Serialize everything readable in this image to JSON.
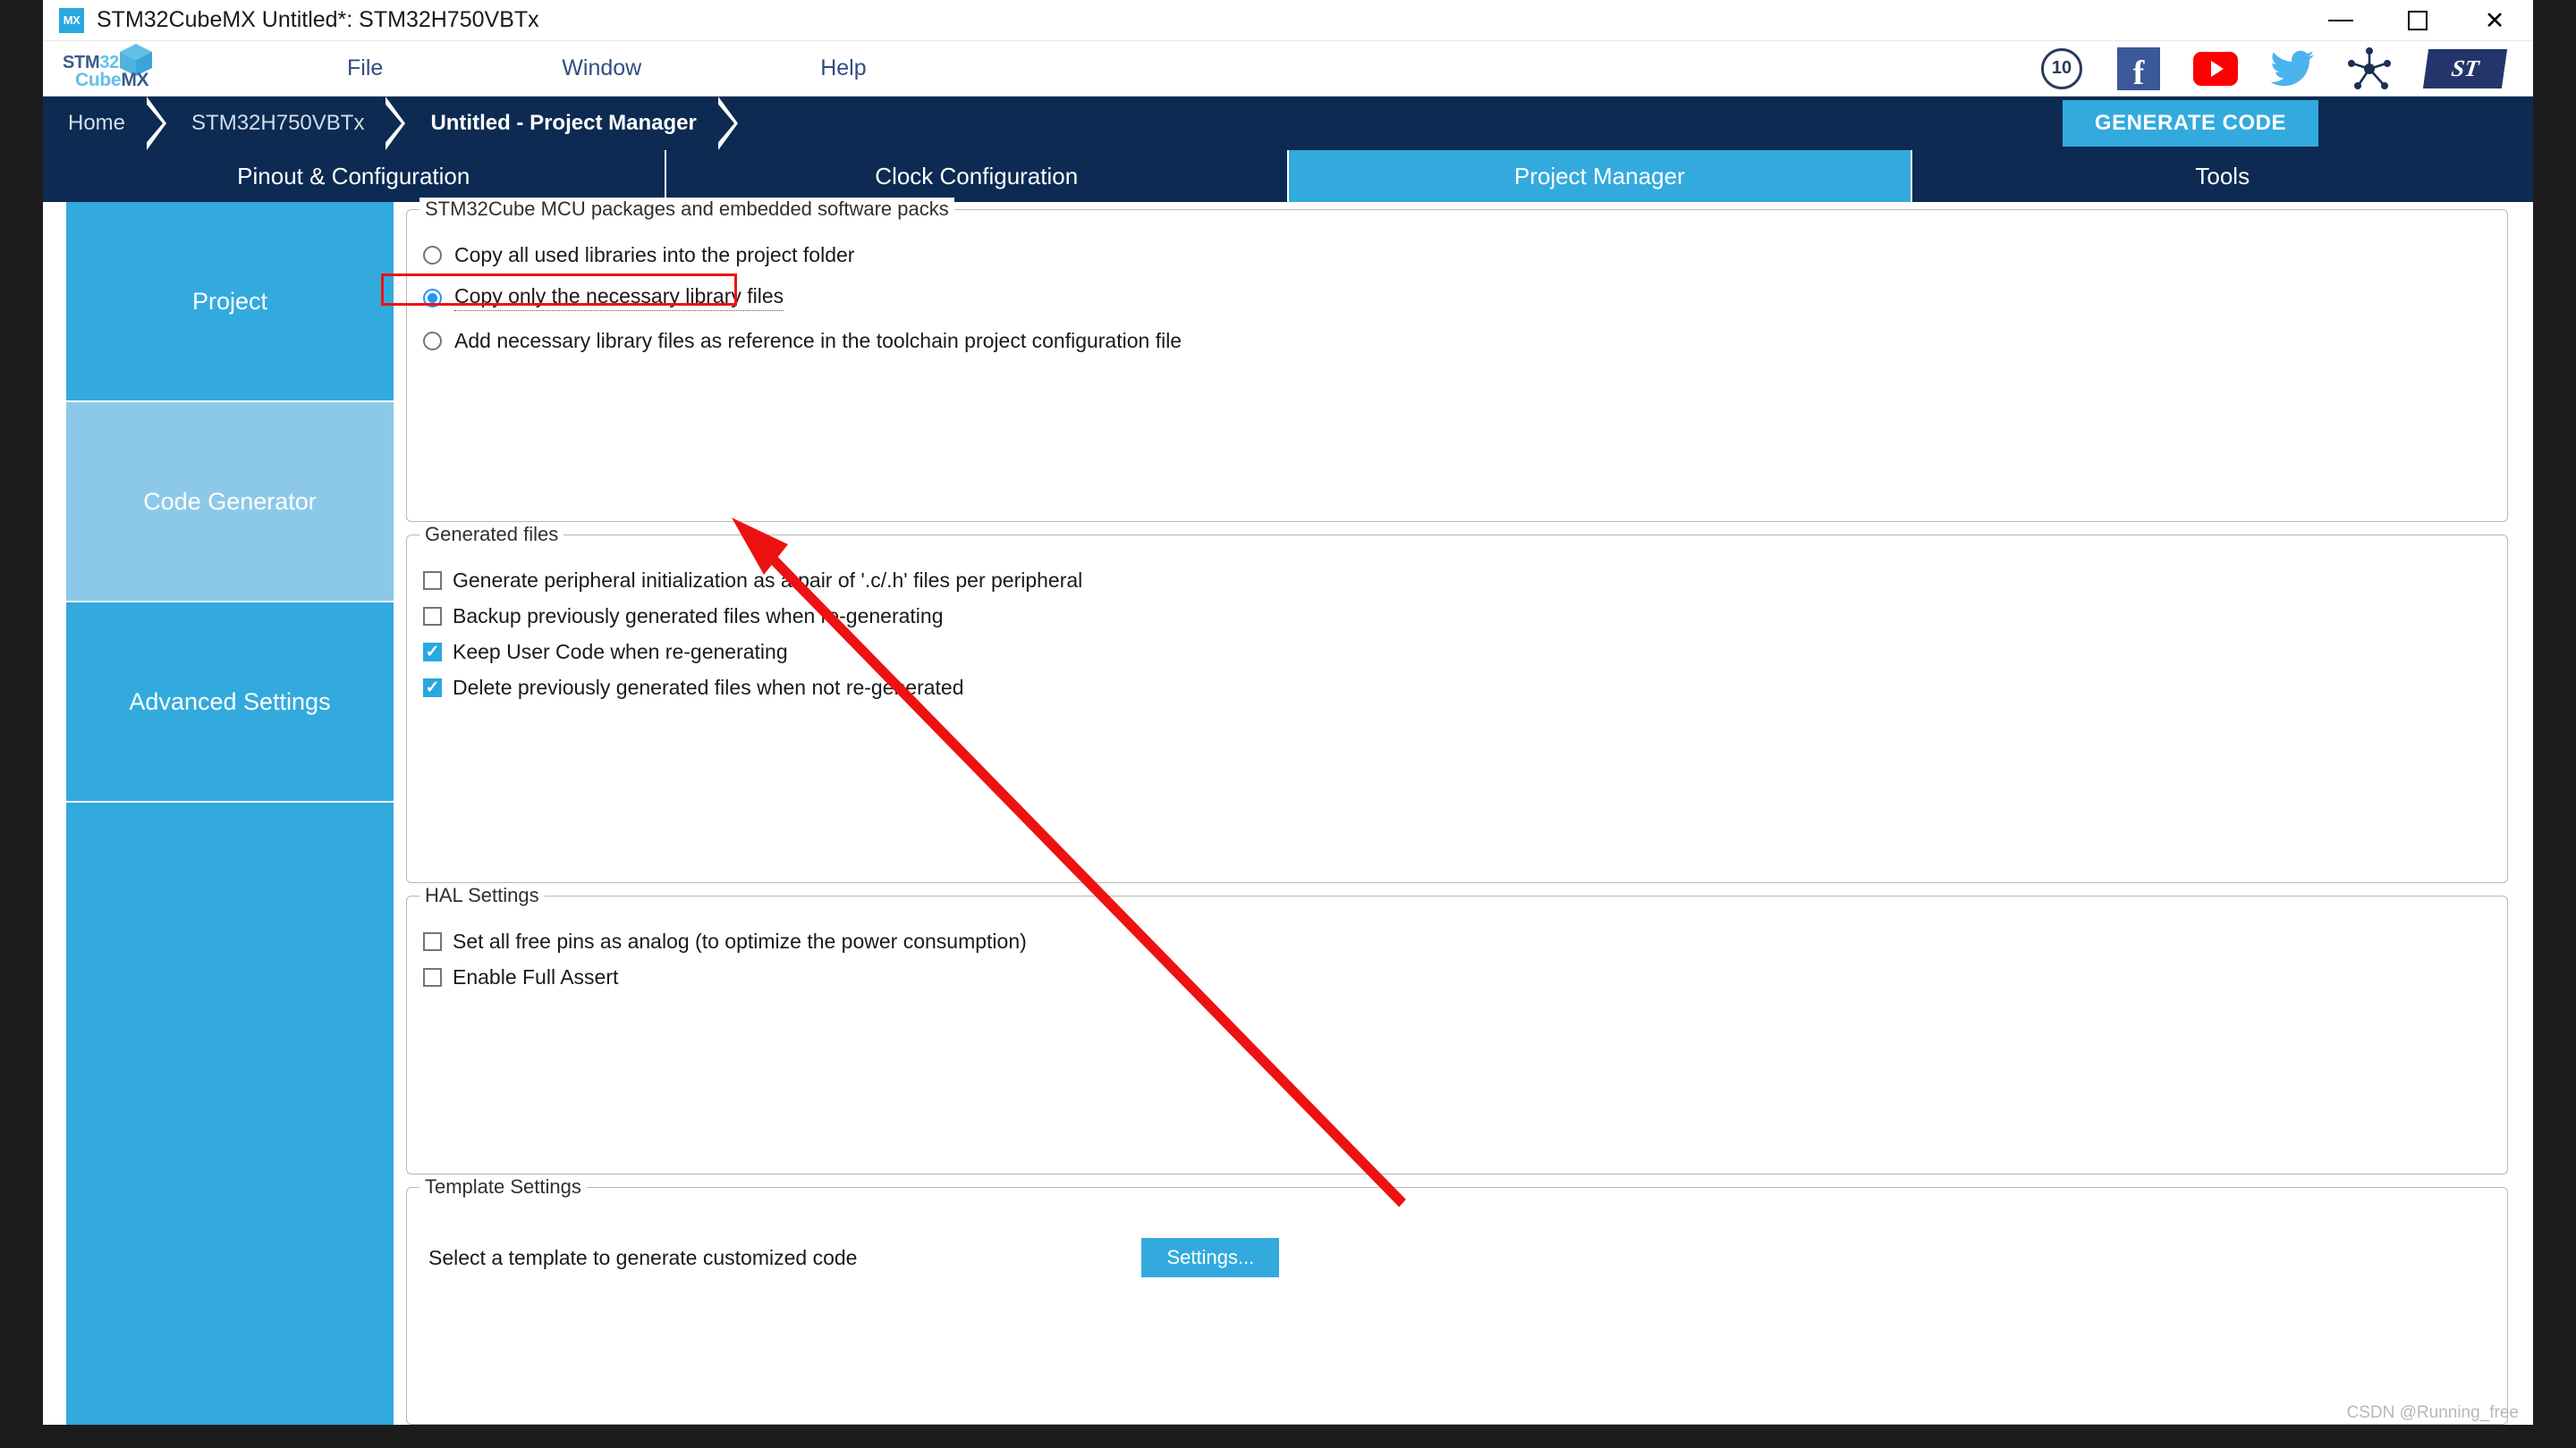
{
  "window": {
    "title": "STM32CubeMX Untitled*: STM32H750VBTx",
    "app_icon": "mx-icon",
    "controls": {
      "minimize": "minimize-icon",
      "maximize": "maximize-icon",
      "close": "close-icon"
    }
  },
  "logo": {
    "line1_a": "STM",
    "line1_b": "32",
    "line2_a": "Cube",
    "line2_b": "MX"
  },
  "menu": {
    "items": [
      "File",
      "Window",
      "Help"
    ]
  },
  "social": {
    "items": [
      {
        "name": "ten-years-badge-icon",
        "label": "10"
      },
      {
        "name": "facebook-icon",
        "label": "f"
      },
      {
        "name": "youtube-icon",
        "label": ""
      },
      {
        "name": "twitter-icon",
        "label": ""
      },
      {
        "name": "community-network-icon",
        "label": ""
      },
      {
        "name": "st-logo-icon",
        "label": "ST"
      }
    ]
  },
  "breadcrumb": {
    "items": [
      {
        "label": "Home",
        "active": false
      },
      {
        "label": "STM32H750VBTx",
        "active": false
      },
      {
        "label": "Untitled - Project Manager",
        "active": true
      }
    ],
    "generate_code": "GENERATE CODE"
  },
  "tabs": [
    {
      "label": "Pinout & Configuration",
      "active": false
    },
    {
      "label": "Clock Configuration",
      "active": false
    },
    {
      "label": "Project Manager",
      "active": true
    },
    {
      "label": "Tools",
      "active": false
    }
  ],
  "sidebar": {
    "items": [
      {
        "label": "Project",
        "selected": false
      },
      {
        "label": "Code Generator",
        "selected": true
      },
      {
        "label": "Advanced Settings",
        "selected": false
      }
    ]
  },
  "groups": {
    "packages": {
      "title": "STM32Cube MCU packages and embedded software packs",
      "options": [
        {
          "label": "Copy all used libraries into the project folder",
          "checked": false
        },
        {
          "label": "Copy only the necessary library files",
          "checked": true
        },
        {
          "label": "Add necessary library files as reference in the toolchain project configuration file",
          "checked": false
        }
      ]
    },
    "generated_files": {
      "title": "Generated files",
      "options": [
        {
          "label": "Generate peripheral initialization as a pair of '.c/.h' files per peripheral",
          "checked": false
        },
        {
          "label": "Backup previously generated files when re-generating",
          "checked": false
        },
        {
          "label": "Keep User Code when re-generating",
          "checked": true
        },
        {
          "label": "Delete previously generated files when not re-generated",
          "checked": true
        }
      ]
    },
    "hal_settings": {
      "title": "HAL Settings",
      "options": [
        {
          "label": "Set all free pins as analog (to optimize the power consumption)",
          "checked": false
        },
        {
          "label": "Enable Full Assert",
          "checked": false
        }
      ]
    },
    "template_settings": {
      "title": "Template Settings",
      "description": "Select a template to generate customized code",
      "button": "Settings..."
    }
  },
  "annotation": {
    "color": "#ee1111",
    "type": "arrow-pointing-to-selected-radio"
  },
  "watermark": "CSDN @Running_free",
  "colors": {
    "accent": "#33aadd",
    "dark_navy": "#0c2a52",
    "sidebar_selected": "#8cc9e8",
    "annotation_red": "#ee1111"
  }
}
